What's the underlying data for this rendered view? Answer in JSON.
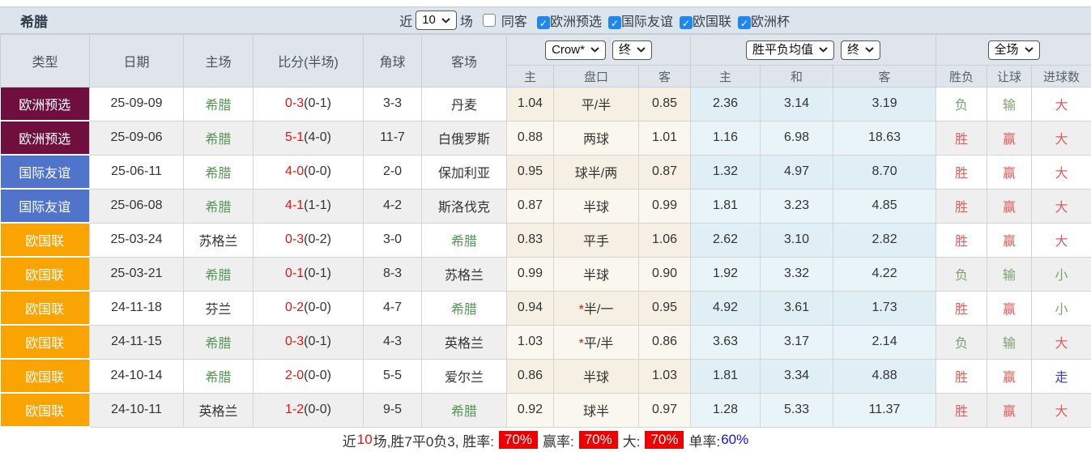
{
  "header": {
    "team_title": "希腊",
    "recent_label": "近",
    "recent_value": "10",
    "matches_label": "场",
    "same_away": {
      "label": "同客",
      "checked": false
    },
    "filters": [
      {
        "label": "欧洲预选",
        "checked": true
      },
      {
        "label": "国际友谊",
        "checked": true
      },
      {
        "label": "欧国联",
        "checked": true
      },
      {
        "label": "欧洲杯",
        "checked": true
      }
    ]
  },
  "table": {
    "columns": {
      "type": "类型",
      "date": "日期",
      "home": "主场",
      "score": "比分(半场)",
      "corners": "角球",
      "away": "客场"
    },
    "selectors": {
      "bookmaker": "Crow*",
      "bookmaker_period": "终",
      "avg": "胜平负均值",
      "avg_period": "终",
      "scope": "全场"
    },
    "sub_headers": [
      "主",
      "盘口",
      "客",
      "主",
      "和",
      "客",
      "胜负",
      "让球",
      "进球数"
    ],
    "league_colors": {
      "qualifier": "#6e0f3e",
      "friendly": "#4f74c9",
      "nations": "#f9a402"
    },
    "value_colors": {
      "胜": "#e25d5d",
      "负": "#7f9f70",
      "赢": "#e25d5d",
      "输": "#7f9f70",
      "大": "#e25d5d",
      "小": "#7f9f70",
      "走": "#3a3ad0"
    },
    "rows": [
      {
        "type": "欧洲预选",
        "league": "qualifier",
        "date": "25-09-09",
        "home": "希腊",
        "home_is_team": true,
        "score": "0-3",
        "half": "(0-1)",
        "corners": "3-3",
        "away": "丹麦",
        "away_is_team": false,
        "odds_home": "1.04",
        "handicap": "平/半",
        "handicap_star": false,
        "odds_away": "0.85",
        "avg_home": "2.36",
        "avg_draw": "3.14",
        "avg_away": "3.19",
        "result": "负",
        "spread": "输",
        "goals": "大"
      },
      {
        "type": "欧洲预选",
        "league": "qualifier",
        "date": "25-09-06",
        "home": "希腊",
        "home_is_team": true,
        "score": "5-1",
        "half": "(4-0)",
        "corners": "11-7",
        "away": "白俄罗斯",
        "away_is_team": false,
        "odds_home": "0.88",
        "handicap": "两球",
        "handicap_star": false,
        "odds_away": "1.01",
        "avg_home": "1.16",
        "avg_draw": "6.98",
        "avg_away": "18.63",
        "result": "胜",
        "spread": "赢",
        "goals": "大"
      },
      {
        "type": "国际友谊",
        "league": "friendly",
        "date": "25-06-11",
        "home": "希腊",
        "home_is_team": true,
        "score": "4-0",
        "half": "(0-0)",
        "corners": "2-0",
        "away": "保加利亚",
        "away_is_team": false,
        "odds_home": "0.95",
        "handicap": "球半/两",
        "handicap_star": false,
        "odds_away": "0.87",
        "avg_home": "1.32",
        "avg_draw": "4.97",
        "avg_away": "8.70",
        "result": "胜",
        "spread": "赢",
        "goals": "大"
      },
      {
        "type": "国际友谊",
        "league": "friendly",
        "date": "25-06-08",
        "home": "希腊",
        "home_is_team": true,
        "score": "4-1",
        "half": "(1-1)",
        "corners": "4-2",
        "away": "斯洛伐克",
        "away_is_team": false,
        "odds_home": "0.87",
        "handicap": "半球",
        "handicap_star": false,
        "odds_away": "0.99",
        "avg_home": "1.81",
        "avg_draw": "3.23",
        "avg_away": "4.85",
        "result": "胜",
        "spread": "赢",
        "goals": "大"
      },
      {
        "type": "欧国联",
        "league": "nations",
        "date": "25-03-24",
        "home": "苏格兰",
        "home_is_team": false,
        "score": "0-3",
        "half": "(0-2)",
        "corners": "3-0",
        "away": "希腊",
        "away_is_team": true,
        "odds_home": "0.83",
        "handicap": "平手",
        "handicap_star": false,
        "odds_away": "1.06",
        "avg_home": "2.62",
        "avg_draw": "3.10",
        "avg_away": "2.82",
        "result": "胜",
        "spread": "赢",
        "goals": "大"
      },
      {
        "type": "欧国联",
        "league": "nations",
        "date": "25-03-21",
        "home": "希腊",
        "home_is_team": true,
        "score": "0-1",
        "half": "(0-1)",
        "corners": "8-3",
        "away": "苏格兰",
        "away_is_team": false,
        "odds_home": "0.99",
        "handicap": "半球",
        "handicap_star": false,
        "odds_away": "0.90",
        "avg_home": "1.92",
        "avg_draw": "3.32",
        "avg_away": "4.22",
        "result": "负",
        "spread": "输",
        "goals": "小"
      },
      {
        "type": "欧国联",
        "league": "nations",
        "date": "24-11-18",
        "home": "芬兰",
        "home_is_team": false,
        "score": "0-2",
        "half": "(0-0)",
        "corners": "4-7",
        "away": "希腊",
        "away_is_team": true,
        "odds_home": "0.94",
        "handicap": "半/一",
        "handicap_star": true,
        "odds_away": "0.95",
        "avg_home": "4.92",
        "avg_draw": "3.61",
        "avg_away": "1.73",
        "result": "胜",
        "spread": "赢",
        "goals": "小"
      },
      {
        "type": "欧国联",
        "league": "nations",
        "date": "24-11-15",
        "home": "希腊",
        "home_is_team": true,
        "score": "0-3",
        "half": "(0-1)",
        "corners": "4-3",
        "away": "英格兰",
        "away_is_team": false,
        "odds_home": "1.03",
        "handicap": "平/半",
        "handicap_star": true,
        "odds_away": "0.86",
        "avg_home": "3.63",
        "avg_draw": "3.17",
        "avg_away": "2.14",
        "result": "负",
        "spread": "输",
        "goals": "大"
      },
      {
        "type": "欧国联",
        "league": "nations",
        "date": "24-10-14",
        "home": "希腊",
        "home_is_team": true,
        "score": "2-0",
        "half": "(0-0)",
        "corners": "5-5",
        "away": "爱尔兰",
        "away_is_team": false,
        "odds_home": "0.86",
        "handicap": "半球",
        "handicap_star": false,
        "odds_away": "1.03",
        "avg_home": "1.81",
        "avg_draw": "3.34",
        "avg_away": "4.88",
        "result": "胜",
        "spread": "赢",
        "goals": "走"
      },
      {
        "type": "欧国联",
        "league": "nations",
        "date": "24-10-11",
        "home": "英格兰",
        "home_is_team": false,
        "score": "1-2",
        "half": "(0-0)",
        "corners": "9-5",
        "away": "希腊",
        "away_is_team": true,
        "odds_home": "0.92",
        "handicap": "球半",
        "handicap_star": false,
        "odds_away": "0.97",
        "avg_home": "1.28",
        "avg_draw": "5.33",
        "avg_away": "11.37",
        "result": "胜",
        "spread": "赢",
        "goals": "大"
      }
    ]
  },
  "footer": {
    "prefix": "近",
    "count": "10",
    "summary": "场,胜7平0负3, 胜率:",
    "win_rate": "70%",
    "profit_label": "赢率:",
    "profit_rate": "70%",
    "big_label": "大:",
    "big_rate": "70%",
    "single_label": "单率:",
    "single_rate": "60%"
  }
}
